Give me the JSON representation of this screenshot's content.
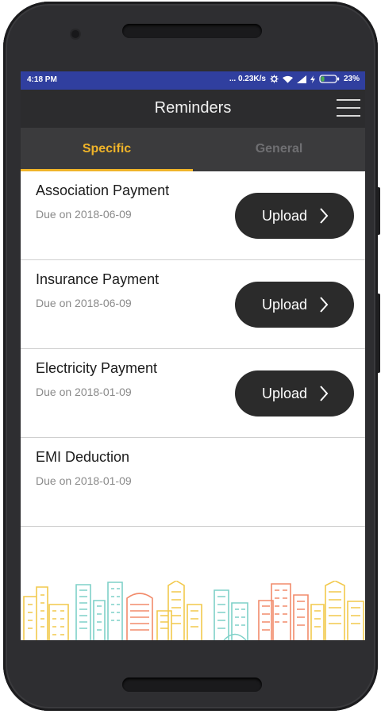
{
  "status_bar": {
    "time": "4:18 PM",
    "network_speed": "... 0.23K/s",
    "battery_percent": "23%",
    "battery_level": 0.23
  },
  "app_bar": {
    "title": "Reminders",
    "menu_icon": "hamburger-menu-icon"
  },
  "tabs": [
    {
      "label": "Specific",
      "active": true
    },
    {
      "label": "General",
      "active": false
    }
  ],
  "reminders": [
    {
      "title": "Association Payment",
      "due": "Due on 2018-06-09",
      "action": "Upload"
    },
    {
      "title": "Insurance Payment",
      "due": "Due on 2018-06-09",
      "action": "Upload"
    },
    {
      "title": "Electricity Payment",
      "due": "Due on 2018-01-09",
      "action": "Upload"
    },
    {
      "title": "EMI Deduction",
      "due": "Due on 2018-01-09",
      "action": null
    }
  ],
  "colors": {
    "status_bar": "#303f9f",
    "app_bar": "#2c2c2e",
    "tab_bar": "#3b3b3d",
    "accent": "#f0b429",
    "button": "#2b2b2b"
  }
}
